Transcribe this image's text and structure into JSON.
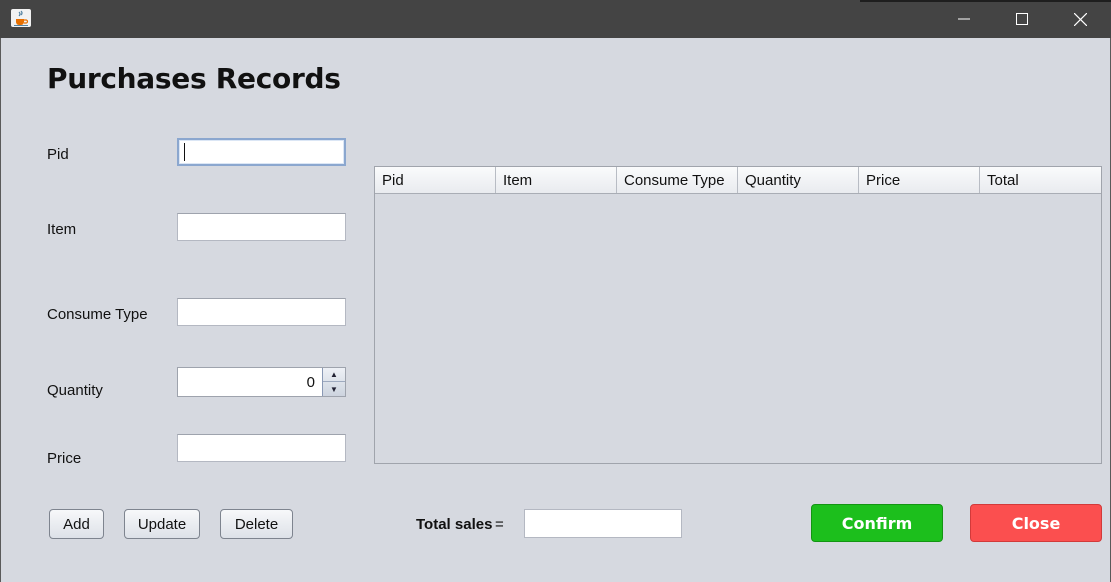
{
  "window": {
    "title_icon": "java-cup-icon",
    "controls": {
      "minimize": "minimize-icon",
      "maximize": "maximize-icon",
      "close": "close-icon"
    }
  },
  "form": {
    "heading": "Purchases Records",
    "labels": {
      "pid": "Pid",
      "item": "Item",
      "consume_type": "Consume Type",
      "quantity": "Quantity",
      "price": "Price"
    },
    "values": {
      "pid": "",
      "item": "",
      "consume_type": "",
      "quantity": "0",
      "price": ""
    }
  },
  "table": {
    "columns": [
      "Pid",
      "Item",
      "Consume Type",
      "Quantity",
      "Price",
      "Total"
    ],
    "rows": []
  },
  "buttons": {
    "add": "Add",
    "update": "Update",
    "delete": "Delete",
    "confirm": "Confirm",
    "close": "Close"
  },
  "totals": {
    "label": "Total sales",
    "equals": "=",
    "value": ""
  },
  "colors": {
    "confirm": "#1cbf1c",
    "close": "#fb4f4f",
    "titlebar": "#444444",
    "background": "#d6d9e0"
  }
}
